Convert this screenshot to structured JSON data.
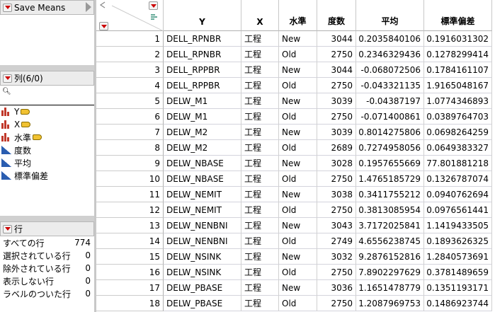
{
  "save_means": {
    "title": "Save Means"
  },
  "columns_panel": {
    "title": "列(6/0)",
    "items": [
      {
        "name": "Y",
        "type": "nominal",
        "tag": true
      },
      {
        "name": "X",
        "type": "nominal",
        "tag": true
      },
      {
        "name": "水準",
        "type": "nominal",
        "tag": true
      },
      {
        "name": "度数",
        "type": "continuous"
      },
      {
        "name": "平均",
        "type": "continuous"
      },
      {
        "name": "標準偏差",
        "type": "continuous"
      }
    ]
  },
  "rows_panel": {
    "title": "行",
    "items": [
      {
        "label": "すべての行",
        "value": "774"
      },
      {
        "label": "選択されている行",
        "value": "0"
      },
      {
        "label": "除外されている行",
        "value": "0"
      },
      {
        "label": "表示しない行",
        "value": "0"
      },
      {
        "label": "ラベルのついた行",
        "value": "0"
      }
    ]
  },
  "table": {
    "headers": [
      "Y",
      "X",
      "水準",
      "度数",
      "平均",
      "標準偏差"
    ],
    "rows": [
      [
        "1",
        "DELL_RPNBR",
        "工程",
        "New",
        "3044",
        "0.2035840106",
        "0.1916031302"
      ],
      [
        "2",
        "DELL_RPNBR",
        "工程",
        "Old",
        "2750",
        "0.2346329436",
        "0.1278299414"
      ],
      [
        "3",
        "DELL_RPPBR",
        "工程",
        "New",
        "3044",
        "-0.068072506",
        "0.1784161107"
      ],
      [
        "4",
        "DELL_RPPBR",
        "工程",
        "Old",
        "2750",
        "-0.043321135",
        "1.9165048167"
      ],
      [
        "5",
        "DELW_M1",
        "工程",
        "New",
        "3039",
        "-0.04387197",
        "1.0774346893"
      ],
      [
        "6",
        "DELW_M1",
        "工程",
        "Old",
        "2750",
        "-0.071400861",
        "0.0389764703"
      ],
      [
        "7",
        "DELW_M2",
        "工程",
        "New",
        "3039",
        "0.8014275806",
        "0.0698264259"
      ],
      [
        "8",
        "DELW_M2",
        "工程",
        "Old",
        "2689",
        "0.7274958056",
        "0.0649383327"
      ],
      [
        "9",
        "DELW_NBASE",
        "工程",
        "New",
        "3028",
        "0.1957655669",
        "77.801881218"
      ],
      [
        "10",
        "DELW_NBASE",
        "工程",
        "Old",
        "2750",
        "1.4765185729",
        "0.1326787074"
      ],
      [
        "11",
        "DELW_NEMIT",
        "工程",
        "New",
        "3038",
        "0.3411755212",
        "0.0940762694"
      ],
      [
        "12",
        "DELW_NEMIT",
        "工程",
        "Old",
        "2750",
        "0.3813085954",
        "0.0976561441"
      ],
      [
        "13",
        "DELW_NENBNI",
        "工程",
        "New",
        "3043",
        "3.7172025841",
        "1.1419433505"
      ],
      [
        "14",
        "DELW_NENBNI",
        "工程",
        "Old",
        "2749",
        "4.6556238745",
        "0.1893626325"
      ],
      [
        "15",
        "DELW_NSINK",
        "工程",
        "New",
        "3032",
        "9.2876152816",
        "1.2840573691"
      ],
      [
        "16",
        "DELW_NSINK",
        "工程",
        "Old",
        "2750",
        "7.8902297629",
        "0.3781489659"
      ],
      [
        "17",
        "DELW_PBASE",
        "工程",
        "New",
        "3036",
        "1.1651478779",
        "0.1351193171"
      ],
      [
        "18",
        "DELW_PBASE",
        "工程",
        "Old",
        "2750",
        "1.2087969753",
        "0.1486923744"
      ]
    ]
  }
}
